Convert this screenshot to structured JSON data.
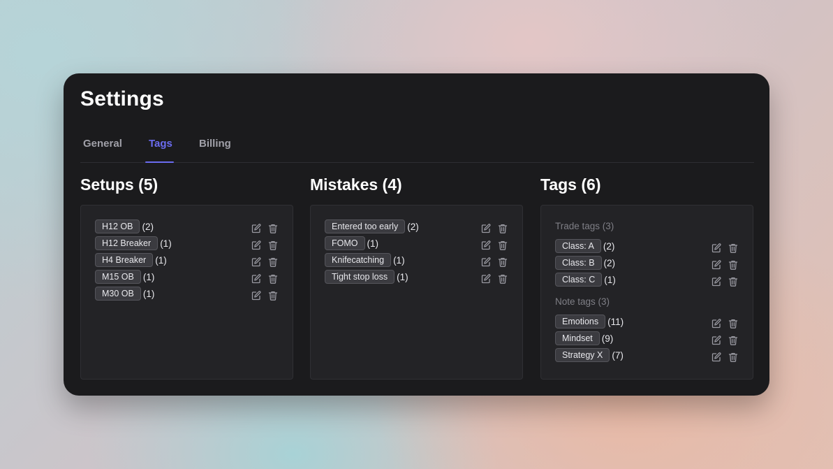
{
  "settings": {
    "title": "Settings",
    "tabs": [
      {
        "label": "General",
        "active": false
      },
      {
        "label": "Tags",
        "active": true
      },
      {
        "label": "Billing",
        "active": false
      }
    ],
    "accent_color": "#6b6cf0",
    "setups": {
      "heading": "Setups (5)",
      "items": [
        {
          "label": "H12 OB",
          "count": "(2)"
        },
        {
          "label": "H12 Breaker",
          "count": "(1)"
        },
        {
          "label": "H4 Breaker",
          "count": "(1)"
        },
        {
          "label": "M15 OB",
          "count": "(1)"
        },
        {
          "label": "M30 OB",
          "count": "(1)"
        }
      ]
    },
    "mistakes": {
      "heading": "Mistakes (4)",
      "items": [
        {
          "label": "Entered too early",
          "count": "(2)"
        },
        {
          "label": "FOMO",
          "count": "(1)"
        },
        {
          "label": "Knifecatching",
          "count": "(1)"
        },
        {
          "label": "Tight stop loss",
          "count": "(1)"
        }
      ]
    },
    "tags": {
      "heading": "Tags (6)",
      "trade_tags": {
        "heading": "Trade tags (3)",
        "items": [
          {
            "label": "Class: A",
            "count": "(2)"
          },
          {
            "label": "Class: B",
            "count": "(2)"
          },
          {
            "label": "Class: C",
            "count": "(1)"
          }
        ]
      },
      "note_tags": {
        "heading": "Note tags (3)",
        "items": [
          {
            "label": "Emotions",
            "count": "(11)"
          },
          {
            "label": "Mindset",
            "count": "(9)"
          },
          {
            "label": "Strategy X",
            "count": "(7)"
          }
        ]
      }
    },
    "icons": {
      "edit": "edit-icon",
      "delete": "trash-icon"
    }
  }
}
